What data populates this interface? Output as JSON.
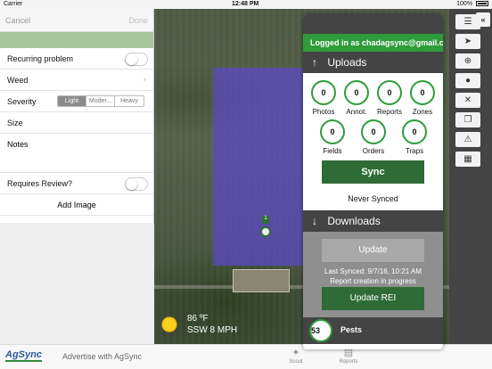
{
  "status_bar": {
    "carrier": "Carrier",
    "time": "12:48 PM",
    "battery": "100%"
  },
  "form": {
    "cancel": "Cancel",
    "done": "Done",
    "recurring_label": "Recurring problem",
    "weed_label": "Weed",
    "severity_label": "Severity",
    "severity_options": [
      "Light",
      "Moder...",
      "Heavy"
    ],
    "size_label": "Size",
    "notes_label": "Notes",
    "requires_review_label": "Requires Review?",
    "add_image": "Add Image"
  },
  "weather": {
    "temp": "86 ºF",
    "wind": "SSW 8 MPH"
  },
  "bottom_bar": {
    "logo": "AgSync",
    "ad": "Advertise with AgSync",
    "tab_scout": "Scout",
    "tab_reports": "Reports"
  },
  "sync": {
    "logged_in": "Logged in as chadagsync@gmail.c",
    "uploads_title": "Uploads",
    "counts": [
      {
        "label": "Photos",
        "value": "0"
      },
      {
        "label": "Annot.",
        "value": "0"
      },
      {
        "label": "Reports",
        "value": "0"
      },
      {
        "label": "Zones",
        "value": "0"
      },
      {
        "label": "Fields",
        "value": "0"
      },
      {
        "label": "Orders",
        "value": "0"
      },
      {
        "label": "Traps",
        "value": "0"
      }
    ],
    "sync_button": "Sync",
    "never_synced": "Never Synced",
    "downloads_title": "Downloads",
    "update_button": "Update",
    "last_synced": "Last Synced: 9/7/16, 10:21 AM",
    "report_progress": "Report creation in progress",
    "update_rei_button": "Update REI",
    "pests_count": "53",
    "pests_label": "Pests"
  },
  "map": {
    "pin_label": "1"
  },
  "colors": {
    "green": "#2f9c3a",
    "dark_green": "#2e6b35",
    "zone": "#5c48c8",
    "toolbar": "#444444"
  }
}
